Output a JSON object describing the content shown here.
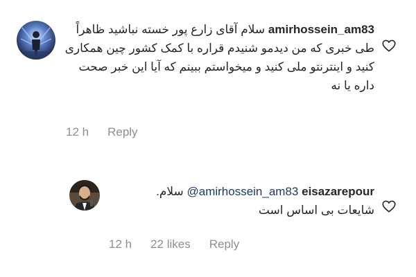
{
  "comments": [
    {
      "username": "amirhossein_am83",
      "text_line1": "سلام آقای زارع پور خسته نباشید ظاهراً",
      "text_rest": "طی خبری که من دیدمو شنیدم قراره با کمک کشور چین همکاری کنید و اینترنتو ملی کنید و میخواستم ببینم که آیا این خبر صحت داره یا نه",
      "time": "12 h",
      "reply_label": "Reply"
    },
    {
      "username": "eisazarepour",
      "mention": "@amirhossein_am83",
      "greeting": "سلام.",
      "text_line2": "شایعات بی اساس است",
      "time": "12 h",
      "likes": "22 likes",
      "reply_label": "Reply"
    }
  ],
  "icons": {
    "like": "heart-outline-icon"
  },
  "colors": {
    "text": "#262626",
    "meta": "#8e8e8e",
    "mention": "#1a3a66"
  }
}
